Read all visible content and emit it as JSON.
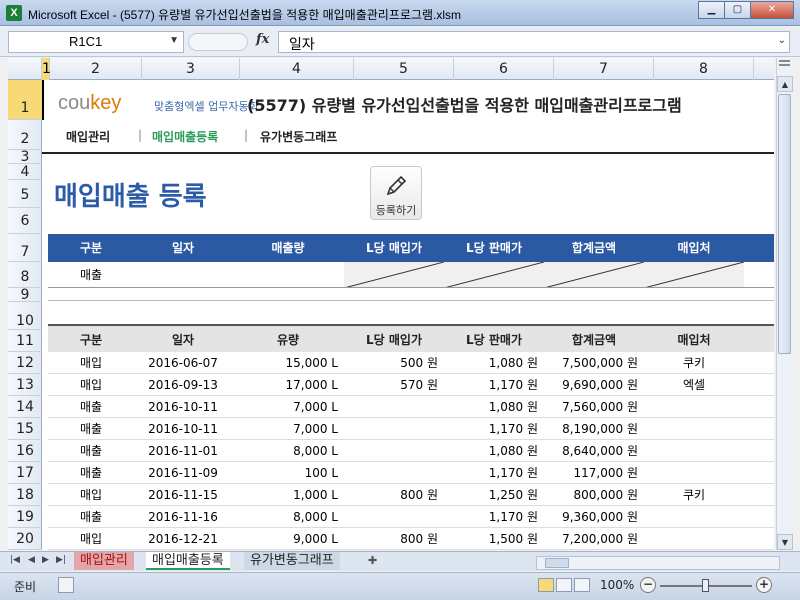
{
  "window": {
    "title": "Microsoft Excel - (5577) 유량별 유가선입선출법을 적용한 매입매출관리프로그램.xlsm"
  },
  "formula_bar": {
    "name_box": "R1C1",
    "fx": "fx",
    "value": "일자"
  },
  "columns": [
    "1",
    "2",
    "3",
    "4",
    "5",
    "6",
    "7",
    "8"
  ],
  "rows": [
    "1",
    "2",
    "3",
    "4",
    "5",
    "6",
    "7",
    "8",
    "9",
    "10",
    "11",
    "12",
    "13",
    "14",
    "15",
    "16",
    "17",
    "18",
    "19",
    "20"
  ],
  "header": {
    "logo_main": "cou",
    "logo_accent": "key",
    "logo_tagline": "맞춤형엑셀 업무자동화",
    "title": "(5577) 유량별 유가선입선출법을 적용한 매입매출관리프로그램"
  },
  "nav": {
    "items": [
      "매입관리",
      "매입매출등록",
      "유가변동그래프"
    ],
    "separator": "|",
    "active_index": 1
  },
  "section_title": "매입매출 등록",
  "register_button": {
    "label": "등록하기",
    "icon": "pencil-icon"
  },
  "input_table": {
    "headers": [
      "구분",
      "일자",
      "매출량",
      "L당 매입가",
      "L당 판매가",
      "합계금액",
      "매입처"
    ],
    "row": [
      "매출",
      "",
      "",
      "",
      "",
      "",
      ""
    ]
  },
  "data_table": {
    "headers": [
      "구분",
      "일자",
      "유량",
      "L당 매입가",
      "L당 판매가",
      "합계금액",
      "매입처"
    ],
    "rows": [
      [
        "매입",
        "2016-06-07",
        "15,000 L",
        "500 원",
        "1,080 원",
        "7,500,000 원",
        "쿠키"
      ],
      [
        "매입",
        "2016-09-13",
        "17,000 L",
        "570 원",
        "1,170 원",
        "9,690,000 원",
        "엑셀"
      ],
      [
        "매출",
        "2016-10-11",
        "7,000 L",
        "",
        "1,080 원",
        "7,560,000 원",
        ""
      ],
      [
        "매출",
        "2016-10-11",
        "7,000 L",
        "",
        "1,170 원",
        "8,190,000 원",
        ""
      ],
      [
        "매출",
        "2016-11-01",
        "8,000 L",
        "",
        "1,080 원",
        "8,640,000 원",
        ""
      ],
      [
        "매출",
        "2016-11-09",
        "100 L",
        "",
        "1,170 원",
        "117,000 원",
        ""
      ],
      [
        "매입",
        "2016-11-15",
        "1,000 L",
        "800 원",
        "1,250 원",
        "800,000 원",
        "쿠키"
      ],
      [
        "매출",
        "2016-11-16",
        "8,000 L",
        "",
        "1,170 원",
        "9,360,000 원",
        ""
      ],
      [
        "매입",
        "2016-12-21",
        "9,000 L",
        "800 원",
        "1,500 원",
        "7,200,000 원",
        ""
      ]
    ]
  },
  "sheet_tabs": [
    "매입관리",
    "매입매출등록",
    "유가변동그래프"
  ],
  "status": {
    "ready": "준비",
    "zoom": "100%"
  },
  "colors": {
    "accent_blue": "#2b5aa3",
    "accent_green": "#2a9d5a",
    "logo_orange": "#e07b00"
  }
}
